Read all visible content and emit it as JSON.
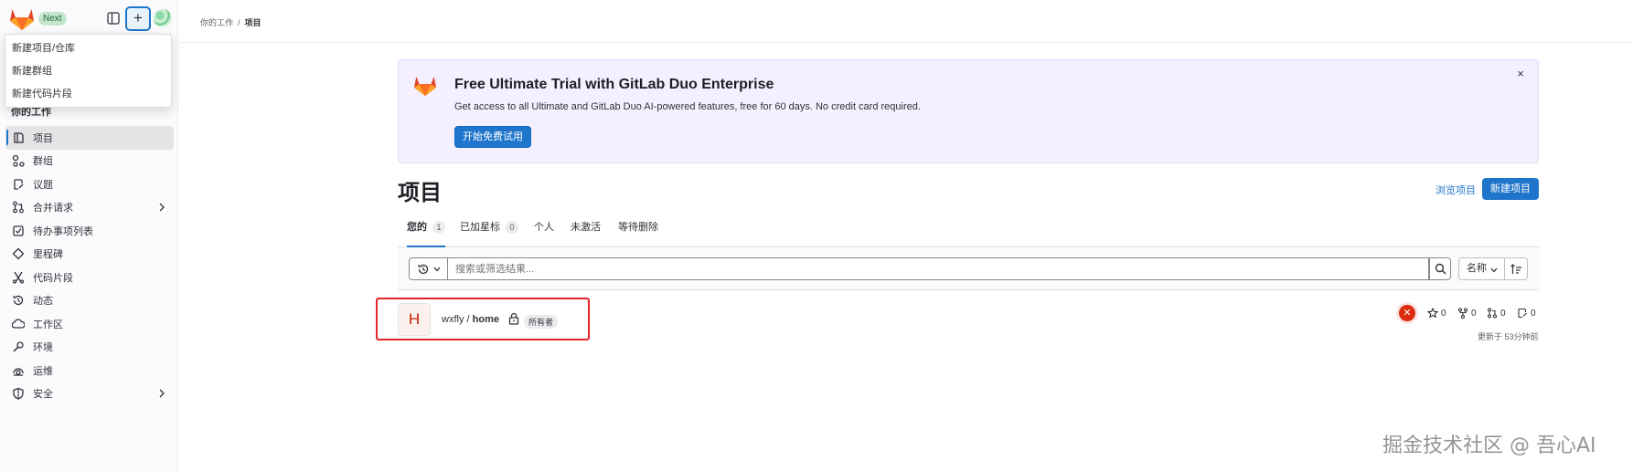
{
  "header": {
    "badge": "Next",
    "plus_symbol": "+"
  },
  "create_menu": {
    "items": [
      "新建项目/仓库",
      "新建群组",
      "新建代码片段"
    ]
  },
  "sidebar": {
    "section_title": "你的工作",
    "items": [
      {
        "label": "项目",
        "icon": "project-icon",
        "active": true
      },
      {
        "label": "群组",
        "icon": "group-icon"
      },
      {
        "label": "议题",
        "icon": "issues-icon"
      },
      {
        "label": "合并请求",
        "icon": "merge-request-icon",
        "has_children": true
      },
      {
        "label": "待办事项列表",
        "icon": "todo-icon"
      },
      {
        "label": "里程碑",
        "icon": "milestone-icon"
      },
      {
        "label": "代码片段",
        "icon": "snippet-icon"
      },
      {
        "label": "动态",
        "icon": "history-icon"
      },
      {
        "label": "工作区",
        "icon": "workspace-icon"
      },
      {
        "label": "环境",
        "icon": "environment-icon"
      },
      {
        "label": "运维",
        "icon": "operations-icon"
      },
      {
        "label": "安全",
        "icon": "shield-icon",
        "has_children": true
      }
    ]
  },
  "breadcrumb": {
    "parent": "你的工作",
    "separator": "/",
    "current": "项目"
  },
  "banner": {
    "title": "Free Ultimate Trial with GitLab Duo Enterprise",
    "text": "Get access to all Ultimate and GitLab Duo AI-powered features, free for 60 days. No credit card required.",
    "button": "开始免费试用",
    "close": "×"
  },
  "page": {
    "title": "项目",
    "browse_link": "浏览项目",
    "new_button": "新建项目"
  },
  "tabs": [
    {
      "label": "您的",
      "count": "1",
      "active": true
    },
    {
      "label": "已加星标",
      "count": "0"
    },
    {
      "label": "个人"
    },
    {
      "label": "未激活"
    },
    {
      "label": "等待删除"
    }
  ],
  "filter": {
    "placeholder": "搜索或筛选结果...",
    "sort_label": "名称"
  },
  "project": {
    "avatar_letter": "H",
    "namespace": "wxfly",
    "separator": " / ",
    "name": "home",
    "role": "所有者",
    "stars": "0",
    "forks": "0",
    "merge_requests": "0",
    "issues": "0",
    "updated": "更新于 53分钟前",
    "pipeline_status": "failed"
  },
  "watermark": "掘金技术社区 @ 吾心AI",
  "colors": {
    "accent": "#1f75cb",
    "banner_bg": "#f4f0ff",
    "highlight": "#e4242a",
    "error": "#dd2b0e"
  }
}
